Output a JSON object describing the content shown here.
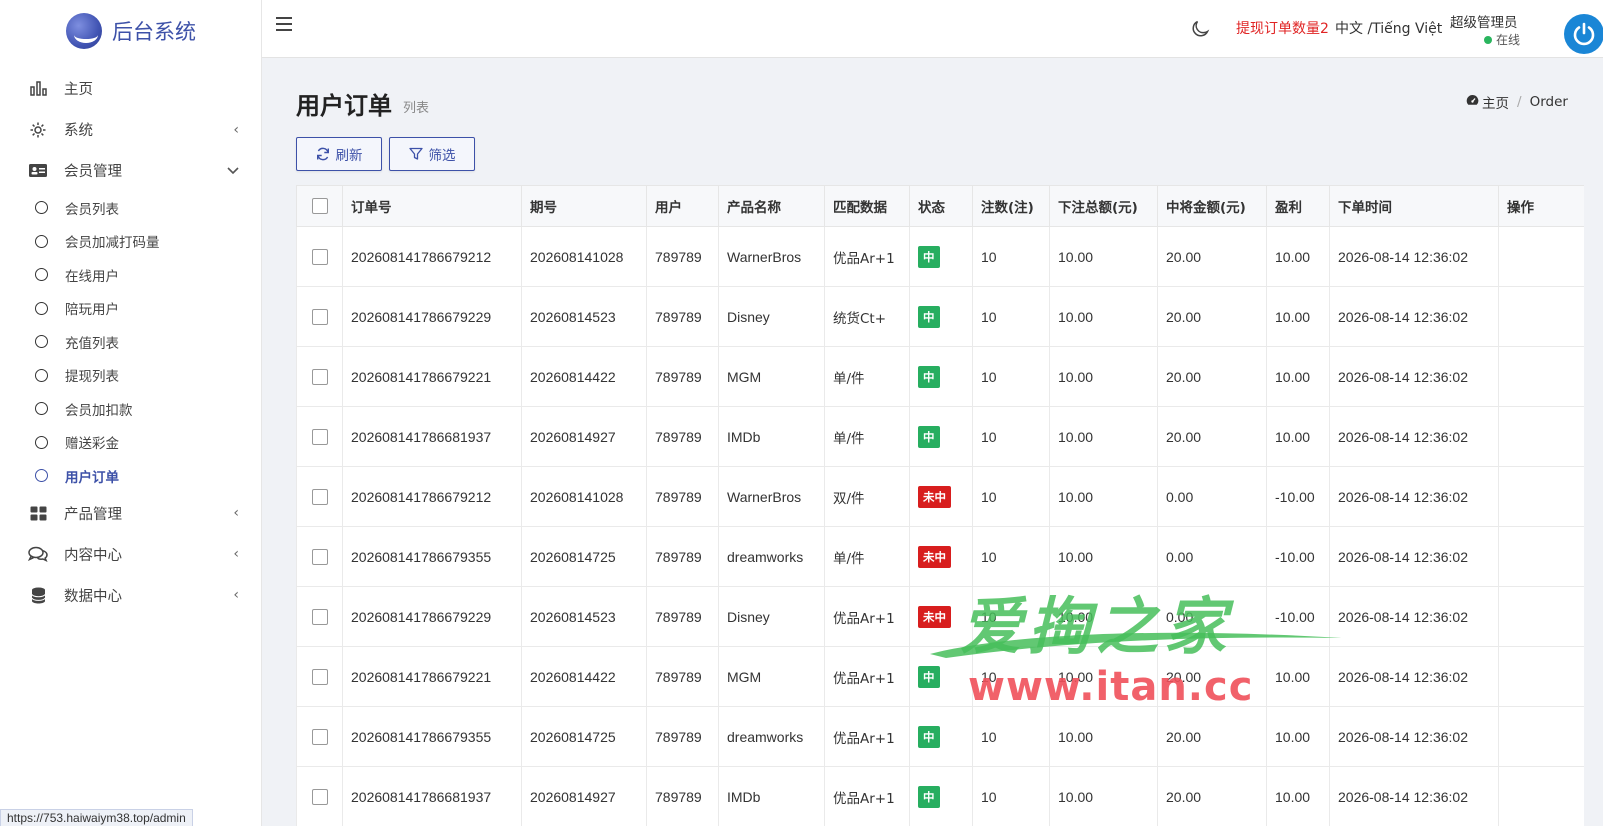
{
  "app": {
    "title": "后台系统"
  },
  "sidebar": {
    "items": [
      {
        "label": "主页",
        "icon": "bar-chart-icon"
      },
      {
        "label": "系统",
        "icon": "gear-icon",
        "arrow": "‹"
      },
      {
        "label": "会员管理",
        "icon": "id-card-icon",
        "arrow": "⌄"
      },
      {
        "label": "产品管理",
        "icon": "grid-icon",
        "arrow": "‹"
      },
      {
        "label": "内容中心",
        "icon": "comments-icon",
        "arrow": "‹"
      },
      {
        "label": "数据中心",
        "icon": "database-icon",
        "arrow": "‹"
      }
    ],
    "submenu": [
      {
        "label": "会员列表"
      },
      {
        "label": "会员加减打码量"
      },
      {
        "label": "在线用户"
      },
      {
        "label": "陪玩用户"
      },
      {
        "label": "充值列表"
      },
      {
        "label": "提现列表"
      },
      {
        "label": "会员加扣款"
      },
      {
        "label": "赠送彩金"
      },
      {
        "label": "用户订单",
        "active": true
      }
    ]
  },
  "header": {
    "withdraw_notice": "提现订单数量2",
    "language": "中文 /Tiếng Việt",
    "user_name": "超级管理员",
    "user_status": "在线"
  },
  "page": {
    "title": "用户订单",
    "subtitle": "列表",
    "breadcrumb_home": "主页",
    "breadcrumb_current": "Order",
    "refresh_label": "刷新",
    "filter_label": "筛选"
  },
  "table": {
    "columns": [
      "订单号",
      "期号",
      "用户",
      "产品名称",
      "匹配数据",
      "状态",
      "注数(注)",
      "下注总额(元)",
      "中将金额(元)",
      "盈利",
      "下单时间",
      "操作"
    ],
    "rows": [
      [
        "202608141786679212",
        "202608141028",
        "789789",
        "WarnerBros",
        "优品Ar+1",
        "中",
        "10",
        "10.00",
        "20.00",
        "10.00",
        "2026-08-14 12:36:02",
        ""
      ],
      [
        "202608141786679229",
        "20260814523",
        "789789",
        "Disney",
        "统货Ct+",
        "中",
        "10",
        "10.00",
        "20.00",
        "10.00",
        "2026-08-14 12:36:02",
        ""
      ],
      [
        "202608141786679221",
        "20260814422",
        "789789",
        "MGM",
        "单/件",
        "中",
        "10",
        "10.00",
        "20.00",
        "10.00",
        "2026-08-14 12:36:02",
        ""
      ],
      [
        "202608141786681937",
        "20260814927",
        "789789",
        "IMDb",
        "单/件",
        "中",
        "10",
        "10.00",
        "20.00",
        "10.00",
        "2026-08-14 12:36:02",
        ""
      ],
      [
        "202608141786679212",
        "202608141028",
        "789789",
        "WarnerBros",
        "双/件",
        "未中",
        "10",
        "10.00",
        "0.00",
        "-10.00",
        "2026-08-14 12:36:02",
        ""
      ],
      [
        "202608141786679355",
        "20260814725",
        "789789",
        "dreamworks",
        "单/件",
        "未中",
        "10",
        "10.00",
        "0.00",
        "-10.00",
        "2026-08-14 12:36:02",
        ""
      ],
      [
        "202608141786679229",
        "20260814523",
        "789789",
        "Disney",
        "优品Ar+1",
        "未中",
        "10",
        "10.00",
        "0.00",
        "-10.00",
        "2026-08-14 12:36:02",
        ""
      ],
      [
        "202608141786679221",
        "20260814422",
        "789789",
        "MGM",
        "优品Ar+1",
        "中",
        "10",
        "10.00",
        "20.00",
        "10.00",
        "2026-08-14 12:36:02",
        ""
      ],
      [
        "202608141786679355",
        "20260814725",
        "789789",
        "dreamworks",
        "优品Ar+1",
        "中",
        "10",
        "10.00",
        "20.00",
        "10.00",
        "2026-08-14 12:36:02",
        ""
      ],
      [
        "202608141786681937",
        "20260814927",
        "789789",
        "IMDb",
        "优品Ar+1",
        "中",
        "10",
        "10.00",
        "20.00",
        "10.00",
        "2026-08-14 12:36:02",
        ""
      ]
    ],
    "status_colors": {
      "中": "#27ae60",
      "未中": "#d81e1e"
    }
  },
  "status_bar": {
    "url": "https://753.haiwaiym38.top/admin"
  },
  "watermark": {
    "cn": "爱掏之家",
    "url": "www.itan.cc"
  },
  "colors": {
    "accent": "#3d51a8",
    "notice": "#e02424",
    "online": "#2ab55e"
  }
}
